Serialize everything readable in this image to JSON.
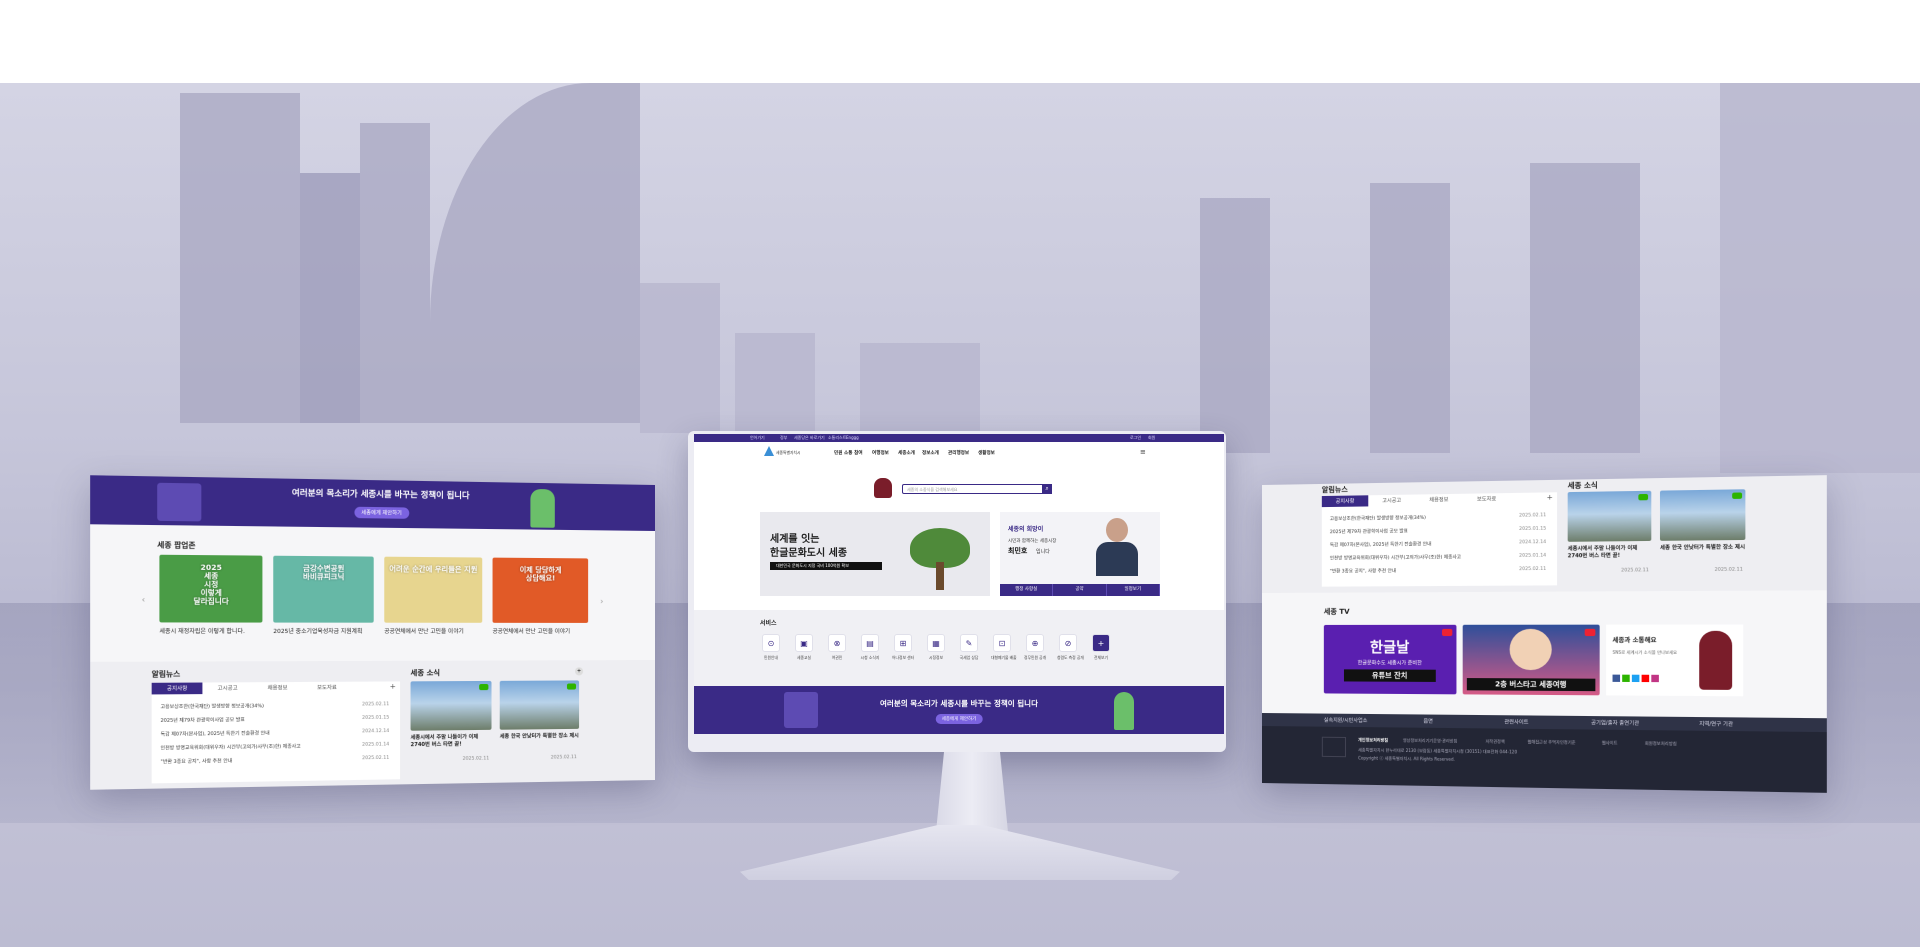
{
  "left": {
    "banner_title": "여러분의 목소리가 세종시를 바꾸는 정책이 됩니다",
    "banner_button": "세종에게 제안하기",
    "section_title": "세종 팝업존",
    "cards": [
      {
        "caption": "세종시 재정자립은 이렇게 합니다.",
        "art": "2025\n세종\n시정\n이렇게\n달라집니다",
        "color": "#4a9c46"
      },
      {
        "caption": "2025년 중소기업육성자금 지원계획",
        "art": "금강수변공원\n바비큐피크닉",
        "color": "#66b8a6"
      },
      {
        "caption": "공공연체에서 만난 고민을 이야기",
        "art": "어려운 순간에 우리들은 지원",
        "color": "#e7d58f"
      },
      {
        "caption": "공공연체에서 만난 고민을 이야기",
        "art": "이제 당당하게\n상담해요!",
        "color": "#e15a27"
      }
    ],
    "news_title": "알림뉴스",
    "tabs": [
      "공지사항",
      "고시공고",
      "채용정보",
      "보도자료"
    ],
    "news": [
      {
        "title": "고용보상조한(한국재단) 발생방향 정보공개(34%)",
        "date": "2025.02.11"
      },
      {
        "title": "2025년 제79차 관광학이사업 공모 발표",
        "date": "2025.01.15"
      },
      {
        "title": "독감 제07차(본사업), 2025년 특한기 전술환경 안내",
        "date": "2024.12.14"
      },
      {
        "title": "인천방 방명교육위회(대위우자) 시간부(고의가)사무(조)한) 제종사고",
        "date": "2025.01.14"
      },
      {
        "title": "\"반환 3종요 공지\", 사항 추천 안내",
        "date": "2025.02.11"
      }
    ],
    "sejong_news_title": "세종 소식",
    "sejong_news": [
      {
        "caption": "세종시에서 주말 나들이가 이제 2740번 버스 타면 끝!",
        "date": "2025.02.11"
      },
      {
        "caption": "세종 한국 안낮터가 특별한 장소 제시",
        "date": "2025.02.11"
      }
    ]
  },
  "center": {
    "topbar": [
      "언어가기",
      "정부",
      "세종당은",
      "바로가기",
      "소통리스트",
      "Enggg",
      "로그인",
      "회원"
    ],
    "logo_text": "세종특별자치시",
    "gnb": [
      "민원 소통 참여",
      "여행정보",
      "세종소개",
      "정보소개",
      "관리행정보",
      "생활정보"
    ],
    "search_placeholder": "세종의 소중식을 검색해보세요",
    "hero_title_1": "세계를 잇는",
    "hero_title_2": "한글문화도시 세종",
    "hero_sub": "대한민국 문화도시 지정 국비 100억원 확보",
    "mayor_tag": "세종의 희망이",
    "mayor_line": "시민과 함께하는 세종시장",
    "mayor_name": "최민호",
    "mayor_suffix": "입니다",
    "mayor_tabs": [
      "행정 사항실",
      "공약",
      "일정보기"
    ],
    "services_title": "서비스",
    "services": [
      {
        "label": "민원안내",
        "icon": "⊙"
      },
      {
        "label": "세종교실",
        "icon": "▣"
      },
      {
        "label": "여권민",
        "icon": "⊗"
      },
      {
        "label": "시청 소식지",
        "icon": "▤"
      },
      {
        "label": "어나정보 센터",
        "icon": "⊞"
      },
      {
        "label": "시정정보",
        "icon": "▦"
      },
      {
        "label": "국세업 상담",
        "icon": "✎"
      },
      {
        "label": "대형폐기물 배출",
        "icon": "⊡"
      },
      {
        "label": "정무민원 공개",
        "icon": "⊕"
      },
      {
        "label": "청렴도 측정 공개",
        "icon": "⊘"
      },
      {
        "label": "전체보기",
        "icon": "+"
      }
    ],
    "banner_title": "여러분의 목소리가 세종시를 바꾸는 정책이 됩니다",
    "banner_button": "세종에게 제안하기"
  },
  "right": {
    "news_title": "알림뉴스",
    "tabs": [
      "공지사항",
      "고시공고",
      "채용정보",
      "보도자료"
    ],
    "news": [
      {
        "title": "고용보상조한(한국재단) 발생방향 정보공개(34%)",
        "date": "2025.02.11"
      },
      {
        "title": "2025년 제79차 관광학이사업 공모 발표",
        "date": "2025.01.15"
      },
      {
        "title": "독감 제07차(본사업), 2025년 특한기 전술환경 안내",
        "date": "2024.12.14"
      },
      {
        "title": "인천방 방명교육위회(대위우자) 시간부(고의가)사무(조)한) 제종사고",
        "date": "2025.01.14"
      },
      {
        "title": "\"반환 3종요 공지\", 사항 추천 안내",
        "date": "2025.02.11"
      }
    ],
    "sejong_news_title": "세종 소식",
    "sejong_news": [
      {
        "caption": "세종시에서 주말 나들이가 이제 2740번 버스 타면 끝!",
        "date": "2025.02.11"
      },
      {
        "caption": "세종 한국 안낮터가 특별한 장소 제시",
        "date": "2025.02.11"
      }
    ],
    "tv_title": "세종 TV",
    "tv_cards": [
      {
        "big": "한글날",
        "sub": "한글문화수도 세종시가 준비한",
        "tag": "유튜브 잔치",
        "color": "#5a1fb0"
      },
      {
        "big": "2층 버스타고 세종여행",
        "color": "#3a6fd0"
      }
    ],
    "social_title": "세종과 소통해요",
    "social_desc": "SNS로 세계시가 소식을 만나보세요",
    "footer_nav": [
      "실속지원/시민사업소",
      "읍면",
      "관련사이트",
      "공기업/출자 출연기관",
      "지역/연구 기관"
    ],
    "footer_links": [
      "개인정보처리방침",
      "영상정보처리기기운영·관리방침",
      "저작권정책",
      "웹해접근성 주먹자인정기준",
      "웹사이트",
      "회원정보처리방침"
    ],
    "footer_address": "세종특별자치시 한누리대로 2130 (보람동) 세종특별자치시청 (30151) 대표전화 044-120",
    "copyright": "Copyright ⓒ 세종특별자치시. All Rights Reserved."
  }
}
